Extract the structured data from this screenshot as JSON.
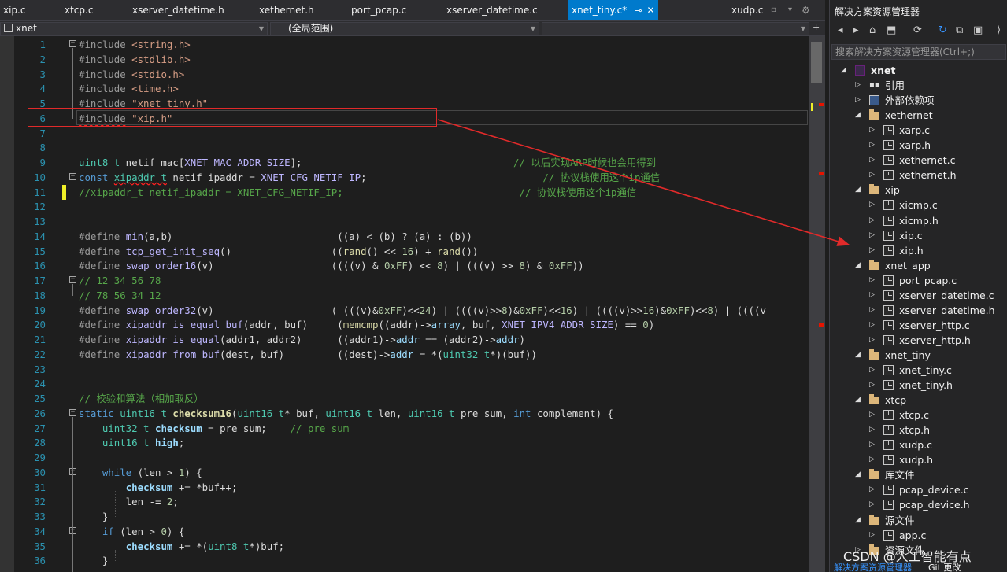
{
  "tabs": [
    {
      "label": "xip.c"
    },
    {
      "label": "xtcp.c"
    },
    {
      "label": "xserver_datetime.h"
    },
    {
      "label": "xethernet.h"
    },
    {
      "label": "port_pcap.c"
    },
    {
      "label": "xserver_datetime.c"
    },
    {
      "label": "xnet_tiny.c*",
      "active": true,
      "pin": "⊸",
      "close": "✕"
    },
    {
      "label": "xudp.c"
    }
  ],
  "tabcontrols": {
    "a": "▫",
    "b": "▾",
    "c": "⚙"
  },
  "navbar": {
    "project": "xnet",
    "scope": "(全局范围)",
    "member": ""
  },
  "lines": [
    {
      "n": "1",
      "fold": "minus",
      "html": "<span class='pp'>#include </span><span class='st'>&lt;string.h&gt;</span>"
    },
    {
      "n": "2",
      "html": "<span class='pp'>#include </span><span class='st'>&lt;stdlib.h&gt;</span>"
    },
    {
      "n": "3",
      "html": "<span class='pp'>#include </span><span class='st'>&lt;stdio.h&gt;</span>"
    },
    {
      "n": "4",
      "html": "<span class='pp'>#include </span><span class='st'>&lt;time.h&gt;</span>"
    },
    {
      "n": "5",
      "html": "<span class='pp'>#include </span><span class='st'>\"xnet_tiny.h\"</span>"
    },
    {
      "n": "6",
      "html": "<span class='pp ul'>#include</span><span class='pp'> </span><span class='st'>\"xip.h\"</span>"
    },
    {
      "n": "7",
      "html": ""
    },
    {
      "n": "8",
      "html": ""
    },
    {
      "n": "9",
      "html": "<span class='ty'>uint8_t</span><span class='pl'> netif_mac[</span><span class='mac'>XNET_MAC_ADDR_SIZE</span><span class='pl'>];                                    </span><span class='cm'>// 以后实现ARP时候也会用得到</span>"
    },
    {
      "n": "10",
      "fold": "minus",
      "html": "<span class='kw'>const</span><span class='pl'> </span><span class='ty ul'>xipaddr_t</span><span class='pl'> netif_ipaddr = </span><span class='mac'>XNET_CFG_NETIF_IP</span><span class='pl'>;                              </span><span class='cm'>// 协议栈使用这个ip通信</span>"
    },
    {
      "n": "11",
      "chg": true,
      "html": "<span class='cm'>//xipaddr_t netif_ipaddr = XNET_CFG_NETIF_IP;                              // 协议栈使用这个ip通信</span>"
    },
    {
      "n": "12",
      "html": ""
    },
    {
      "n": "13",
      "html": ""
    },
    {
      "n": "14",
      "html": "<span class='pp'>#define </span><span class='mac'>min</span><span class='pl'>(a,b)                            ((a) &lt; (b) ? (a) : (b))</span>"
    },
    {
      "n": "15",
      "html": "<span class='pp'>#define </span><span class='mac'>tcp_get_init_seq</span><span class='pl'>()                 ((</span><span class='fn'>rand</span><span class='pl'>() &lt;&lt; </span><span class='nm'>16</span><span class='pl'>) + </span><span class='fn'>rand</span><span class='pl'>())</span>"
    },
    {
      "n": "16",
      "html": "<span class='pp'>#define </span><span class='mac'>swap_order16</span><span class='pl'>(v)                    ((((v) &amp; </span><span class='nm'>0xFF</span><span class='pl'>) &lt;&lt; </span><span class='nm'>8</span><span class='pl'>) | (((v) &gt;&gt; </span><span class='nm'>8</span><span class='pl'>) &amp; </span><span class='nm'>0xFF</span><span class='pl'>))</span>"
    },
    {
      "n": "17",
      "fold": "minus",
      "html": "<span class='cm'>// 12 34 56 78</span>"
    },
    {
      "n": "18",
      "html": "<span class='cm'>// 78 56 34 12</span>"
    },
    {
      "n": "19",
      "html": "<span class='pp'>#define </span><span class='mac'>swap_order32</span><span class='pl'>(v)                    ( (((v)&amp;</span><span class='nm'>0xFF</span><span class='pl'>)&lt;&lt;</span><span class='nm'>24</span><span class='pl'>) | ((((v)&gt;&gt;</span><span class='nm'>8</span><span class='pl'>)&amp;</span><span class='nm'>0xFF</span><span class='pl'>)&lt;&lt;</span><span class='nm'>16</span><span class='pl'>) | ((((v)&gt;&gt;</span><span class='nm'>16</span><span class='pl'>)&amp;</span><span class='nm'>0xFF</span><span class='pl'>)&lt;&lt;</span><span class='nm'>8</span><span class='pl'>) | ((((v</span>"
    },
    {
      "n": "20",
      "html": "<span class='pp'>#define </span><span class='mac'>xipaddr_is_equal_buf</span><span class='pl'>(addr, buf)     (</span><span class='fn'>memcmp</span><span class='pl'>((addr)-&gt;</span><span class='vr'>array</span><span class='pl'>, buf, </span><span class='mac'>XNET_IPV4_ADDR_SIZE</span><span class='pl'>) == </span><span class='nm'>0</span><span class='pl'>)</span>"
    },
    {
      "n": "21",
      "html": "<span class='pp'>#define </span><span class='mac'>xipaddr_is_equal</span><span class='pl'>(addr1, addr2)      ((addr1)-&gt;</span><span class='vr'>addr</span><span class='pl'> == (addr2)-&gt;</span><span class='vr'>addr</span><span class='pl'>)</span>"
    },
    {
      "n": "22",
      "html": "<span class='pp'>#define </span><span class='mac'>xipaddr_from_buf</span><span class='pl'>(dest, buf)         ((dest)-&gt;</span><span class='vr'>addr</span><span class='pl'> = *(</span><span class='ty'>uint32_t</span><span class='pl'>*)(buf))</span>"
    },
    {
      "n": "23",
      "html": ""
    },
    {
      "n": "24",
      "html": ""
    },
    {
      "n": "25",
      "html": "<span class='cm'>// 校验和算法（相加取反）</span>"
    },
    {
      "n": "26",
      "fold": "minus",
      "html": "<span class='kw'>static</span><span class='pl'> </span><span class='ty'>uint16_t</span><span class='pl'> </span><span class='fn bold'>checksum16</span><span class='pl'>(</span><span class='ty'>uint16_t</span><span class='pl'>* buf, </span><span class='ty'>uint16_t</span><span class='pl'> len, </span><span class='ty'>uint16_t</span><span class='pl'> pre_sum, </span><span class='kw'>int</span><span class='pl'> complement) {</span>"
    },
    {
      "n": "27",
      "html": "<span class='pl'>    </span><span class='ty'>uint32_t</span><span class='pl'> </span><span class='vr bold'>checksum</span><span class='pl'> = pre_sum;    </span><span class='cm'>// pre_sum</span>"
    },
    {
      "n": "28",
      "html": "<span class='pl'>    </span><span class='ty'>uint16_t</span><span class='pl'> </span><span class='vr bold'>high</span><span class='pl'>;</span>"
    },
    {
      "n": "29",
      "html": ""
    },
    {
      "n": "30",
      "fold": "minus",
      "html": "<span class='pl'>    </span><span class='kw'>while</span><span class='pl'> (len &gt; </span><span class='nm'>1</span><span class='pl'>) {</span>"
    },
    {
      "n": "31",
      "html": "<span class='pl'>        </span><span class='vr bold'>checksum</span><span class='pl'> += *buf++;</span>"
    },
    {
      "n": "32",
      "html": "<span class='pl'>        len -= </span><span class='nm'>2</span><span class='pl'>;</span>"
    },
    {
      "n": "33",
      "html": "<span class='pl'>    }</span>"
    },
    {
      "n": "34",
      "fold": "minus",
      "html": "<span class='pl'>    </span><span class='kw'>if</span><span class='pl'> (len &gt; </span><span class='nm'>0</span><span class='pl'>) {</span>"
    },
    {
      "n": "35",
      "html": "<span class='pl'>        </span><span class='vr bold'>checksum</span><span class='pl'> += *(</span><span class='ty'>uint8_t</span><span class='pl'>*)buf;</span>"
    },
    {
      "n": "36",
      "html": "<span class='pl'>    }</span>"
    }
  ],
  "solution_explorer": {
    "title": "解决方案资源管理器",
    "search_placeholder": "搜索解决方案资源管理器(Ctrl+;)",
    "toolbar_icons": [
      "◂",
      "▸",
      "⌂",
      "⬒",
      "⟳",
      "↻",
      "⧉",
      "▣",
      "⟩"
    ],
    "tree": [
      {
        "label": "xnet",
        "level": 0,
        "type": "sol",
        "expanded": true,
        "bold": true
      },
      {
        "label": "引用",
        "level": 1,
        "type": "refs",
        "expanded": false
      },
      {
        "label": "外部依赖项",
        "level": 1,
        "type": "ext",
        "expanded": false
      },
      {
        "label": "xethernet",
        "level": 1,
        "type": "folder",
        "expanded": true
      },
      {
        "label": "xarp.c",
        "level": 2,
        "type": "file",
        "expanded": false
      },
      {
        "label": "xarp.h",
        "level": 2,
        "type": "file",
        "expanded": false
      },
      {
        "label": "xethernet.c",
        "level": 2,
        "type": "file",
        "expanded": false
      },
      {
        "label": "xethernet.h",
        "level": 2,
        "type": "file",
        "expanded": false
      },
      {
        "label": "xip",
        "level": 1,
        "type": "folder",
        "expanded": true
      },
      {
        "label": "xicmp.c",
        "level": 2,
        "type": "file",
        "expanded": false
      },
      {
        "label": "xicmp.h",
        "level": 2,
        "type": "file",
        "expanded": false
      },
      {
        "label": "xip.c",
        "level": 2,
        "type": "file",
        "expanded": false
      },
      {
        "label": "xip.h",
        "level": 2,
        "type": "file",
        "expanded": false
      },
      {
        "label": "xnet_app",
        "level": 1,
        "type": "folder",
        "expanded": true
      },
      {
        "label": "port_pcap.c",
        "level": 2,
        "type": "file",
        "expanded": false
      },
      {
        "label": "xserver_datetime.c",
        "level": 2,
        "type": "file",
        "expanded": false
      },
      {
        "label": "xserver_datetime.h",
        "level": 2,
        "type": "file",
        "expanded": false
      },
      {
        "label": "xserver_http.c",
        "level": 2,
        "type": "file",
        "expanded": false
      },
      {
        "label": "xserver_http.h",
        "level": 2,
        "type": "file",
        "expanded": false
      },
      {
        "label": "xnet_tiny",
        "level": 1,
        "type": "folder",
        "expanded": true
      },
      {
        "label": "xnet_tiny.c",
        "level": 2,
        "type": "file",
        "expanded": false
      },
      {
        "label": "xnet_tiny.h",
        "level": 2,
        "type": "file",
        "expanded": false
      },
      {
        "label": "xtcp",
        "level": 1,
        "type": "folder",
        "expanded": true
      },
      {
        "label": "xtcp.c",
        "level": 2,
        "type": "file",
        "expanded": false
      },
      {
        "label": "xtcp.h",
        "level": 2,
        "type": "file",
        "expanded": false
      },
      {
        "label": "xudp.c",
        "level": 2,
        "type": "file",
        "expanded": false
      },
      {
        "label": "xudp.h",
        "level": 2,
        "type": "file",
        "expanded": false
      },
      {
        "label": "库文件",
        "level": 1,
        "type": "folder",
        "expanded": true
      },
      {
        "label": "pcap_device.c",
        "level": 2,
        "type": "file",
        "expanded": false
      },
      {
        "label": "pcap_device.h",
        "level": 2,
        "type": "file",
        "expanded": false
      },
      {
        "label": "源文件",
        "level": 1,
        "type": "folder",
        "expanded": true
      },
      {
        "label": "app.c",
        "level": 2,
        "type": "file",
        "expanded": false
      },
      {
        "label": "资源文件",
        "level": 1,
        "type": "folder",
        "expanded": false
      }
    ],
    "bottom_tabs": [
      "解决方案资源管理器",
      "Git 更改"
    ]
  },
  "watermark": "CSDN @人工智能有点",
  "colors": {
    "accent": "#007acc",
    "annotation": "#e12a2a"
  }
}
